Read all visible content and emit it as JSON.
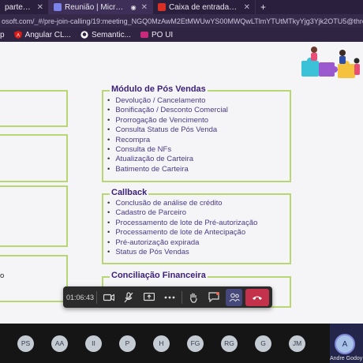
{
  "browser": {
    "tabs": [
      {
        "title": "parte 4: lapid",
        "active": false,
        "color": "#6d5a9c"
      },
      {
        "title": "Reunião | Microsoft",
        "active": true,
        "color": "#7b83eb"
      },
      {
        "title": "Caixa de entrada - vid",
        "active": false,
        "color": "#d93025"
      }
    ],
    "new_tab_label": "+",
    "url": "osoft.com/_#/pre-join-calling/19:meeting_NGQ0MzAwM2EtMWUwYS00MWQwLTlmYTUtMTkyYjg3Yjk2OTU5@thread.v2",
    "bookmarks": [
      {
        "label": "p",
        "icon": "none"
      },
      {
        "label": "Angular CL...",
        "icon": "angular-icon"
      },
      {
        "label": "Semantic...",
        "icon": "github-icon"
      },
      {
        "label": "PO UI",
        "icon": "po-ui-icon"
      }
    ]
  },
  "slide": {
    "left_fragment_text": "o",
    "sections": [
      {
        "title": "Módulo de Pós Vendas",
        "items": [
          "Devolução / Cancelamento",
          "Bonificação / Desconto Comercial",
          "Prorrogação de Vencimento",
          "Consulta Status de Pós Venda",
          "Recompra",
          "Consulta de NFs",
          "Atualização de Carteira",
          "Batimento de Carteira"
        ]
      },
      {
        "title": "Callback",
        "items": [
          "Conclusão de análise de crédito",
          "Cadastro de Parceiro",
          "Processamento de lote de Pré-autorização",
          "Processamento de lote de Antecipação",
          "Pré-autorização expirada",
          "Status de Pós Vendas"
        ]
      },
      {
        "title": "Conciliação Financeira",
        "items": []
      }
    ],
    "accent_color": "#b8d774",
    "title_color": "#3a1f78"
  },
  "meeting": {
    "timer": "01:06:43",
    "controls": [
      "camera-icon",
      "mic-off-icon",
      "share-screen-icon",
      "more-icon",
      "raise-hand-icon",
      "chat-icon",
      "people-icon",
      "hang-up-icon"
    ]
  },
  "participants": [
    "PS",
    "AA",
    "II",
    "P",
    "H",
    "FG",
    "RG",
    "G",
    "JM"
  ],
  "self": {
    "initials": "A",
    "name": "Andre Godoy"
  }
}
